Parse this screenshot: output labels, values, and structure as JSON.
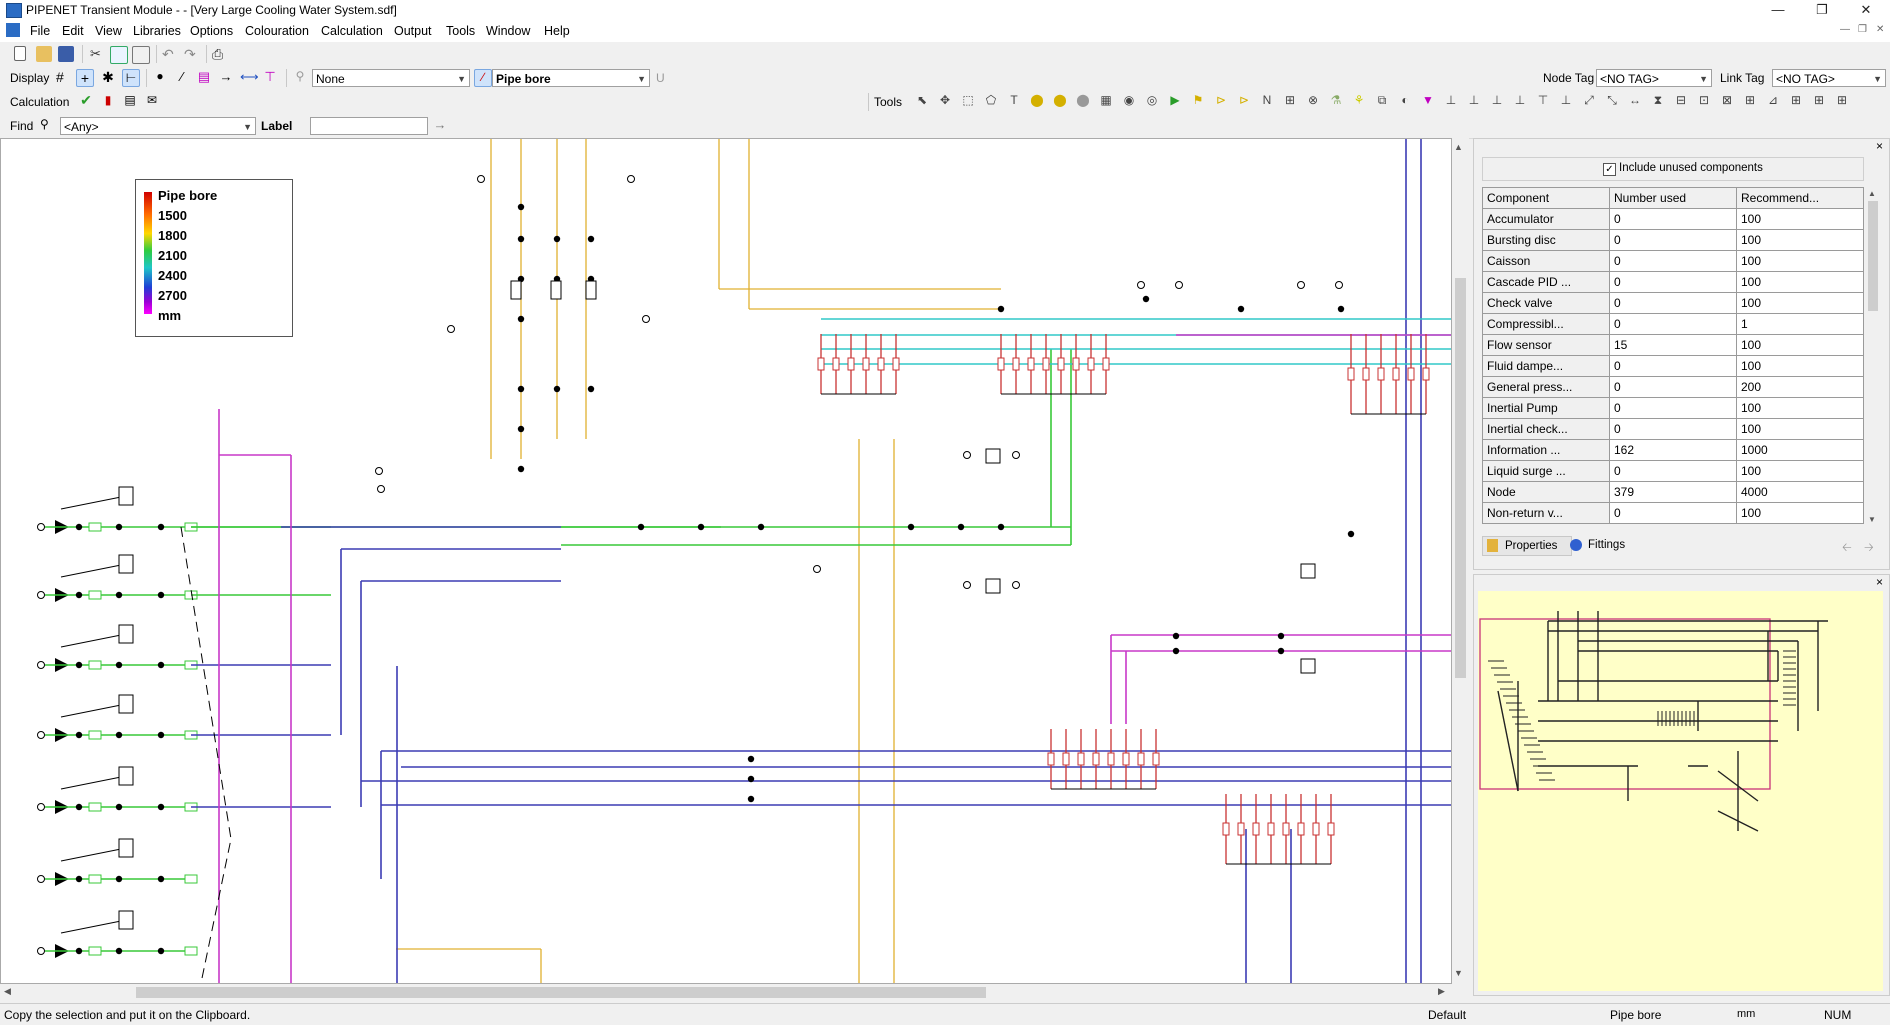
{
  "window": {
    "title": "PIPENET Transient Module -  - [Very Large Cooling Water System.sdf]"
  },
  "menu": [
    "File",
    "Edit",
    "View",
    "Libraries",
    "Options",
    "Colouration",
    "Calculation",
    "Output",
    "Tools",
    "Window",
    "Help"
  ],
  "toolbar_display": {
    "display_label": "Display",
    "filter_value": "None",
    "colour_by_value": "Pipe bore",
    "u_label": "U",
    "node_tag_label": "Node Tag",
    "node_tag_value": "<NO TAG>",
    "link_tag_label": "Link Tag",
    "link_tag_value": "<NO TAG>"
  },
  "toolbar_calc": {
    "calculation_label": "Calculation",
    "tools_label": "Tools"
  },
  "toolbar_find": {
    "find_label": "Find",
    "find_value": "<Any>",
    "label_label": "Label",
    "label_value": ""
  },
  "legend": {
    "title": "Pipe bore",
    "values": [
      "1500",
      "1800",
      "2100",
      "2400",
      "2700"
    ],
    "unit": "mm",
    "colors": [
      "#d00000",
      "#ff6a00",
      "#2ecc40",
      "#1fc7c7",
      "#1f3fd6",
      "#9b00d6",
      "#ff00ff"
    ]
  },
  "components_panel": {
    "include_unused_label": "Include unused components",
    "include_unused_checked": true,
    "headers": [
      "Component",
      "Number used",
      "Recommend..."
    ],
    "rows": [
      [
        "Accumulator",
        "0",
        "100"
      ],
      [
        "Bursting disc",
        "0",
        "100"
      ],
      [
        "Caisson",
        "0",
        "100"
      ],
      [
        "Cascade PID ...",
        "0",
        "100"
      ],
      [
        "Check valve",
        "0",
        "100"
      ],
      [
        "Compressibl...",
        "0",
        "1"
      ],
      [
        "Flow sensor",
        "15",
        "100"
      ],
      [
        "Fluid dampe...",
        "0",
        "100"
      ],
      [
        "General press...",
        "0",
        "200"
      ],
      [
        "Inertial Pump",
        "0",
        "100"
      ],
      [
        "Inertial check...",
        "0",
        "100"
      ],
      [
        "Information ...",
        "162",
        "1000"
      ],
      [
        "Liquid surge ...",
        "0",
        "100"
      ],
      [
        "Node",
        "379",
        "4000"
      ],
      [
        "Non-return v...",
        "0",
        "100"
      ]
    ],
    "tab_properties": "Properties",
    "tab_fittings": "Fittings"
  },
  "status": {
    "message": "Copy the selection and put it on the Clipboard.",
    "scheme": "Default",
    "colour_by": "Pipe bore",
    "unit": "mm",
    "num": "NUM"
  }
}
